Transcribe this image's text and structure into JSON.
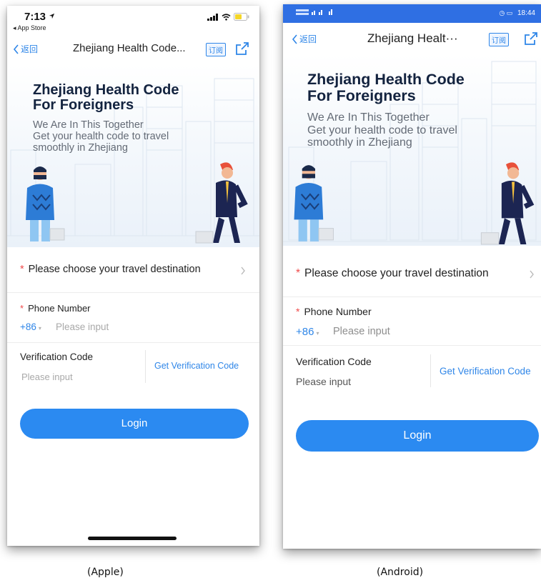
{
  "apple": {
    "status_time": "7:13",
    "status_back": "◂ App Store",
    "nav_back": "返回",
    "nav_title": "Zhejiang Health Code...",
    "nav_subscribe": "订阅",
    "hero_title_1": "Zhejiang Health Code",
    "hero_title_2": "For Foreigners",
    "hero_sub_1": "We Are In This Together",
    "hero_sub_2": "Get your health code to travel",
    "hero_sub_3": "smoothly in Zhejiang",
    "destination_label": "Please choose your travel destination",
    "phone_label": "Phone Number",
    "country_code": "+86",
    "phone_placeholder": "Please input",
    "verify_label": "Verification Code",
    "verify_placeholder": "Please input",
    "get_code_label": "Get Verification Code",
    "login_label": "Login",
    "caption": "(Apple)"
  },
  "android": {
    "status_time": "18:44",
    "nav_back": "返回",
    "nav_title": "Zhejiang Healt···",
    "nav_subscribe": "订阅",
    "hero_title_1": "Zhejiang Health Code",
    "hero_title_2": "For Foreigners",
    "hero_sub_1": "We Are In This Together",
    "hero_sub_2": "Get your health code to travel",
    "hero_sub_3": "smoothly in Zhejiang",
    "destination_label": "Please choose your travel destination",
    "phone_label": "Phone Number",
    "country_code": "+86",
    "phone_placeholder": "Please input",
    "verify_label": "Verification Code",
    "verify_placeholder": "Please input",
    "get_code_label": "Get Verification Code",
    "login_label": "Login",
    "caption": "(Android)"
  },
  "colors": {
    "accent": "#2f86e8",
    "login_button": "#2b8af1",
    "required": "#f04a4a",
    "android_status_bar": "#2f6fe3",
    "hero_title": "#13233f"
  },
  "icons": {
    "back": "chevron-left-icon",
    "share": "share-icon",
    "chevron": "chevron-right-icon",
    "dropdown": "caret-down-icon"
  }
}
